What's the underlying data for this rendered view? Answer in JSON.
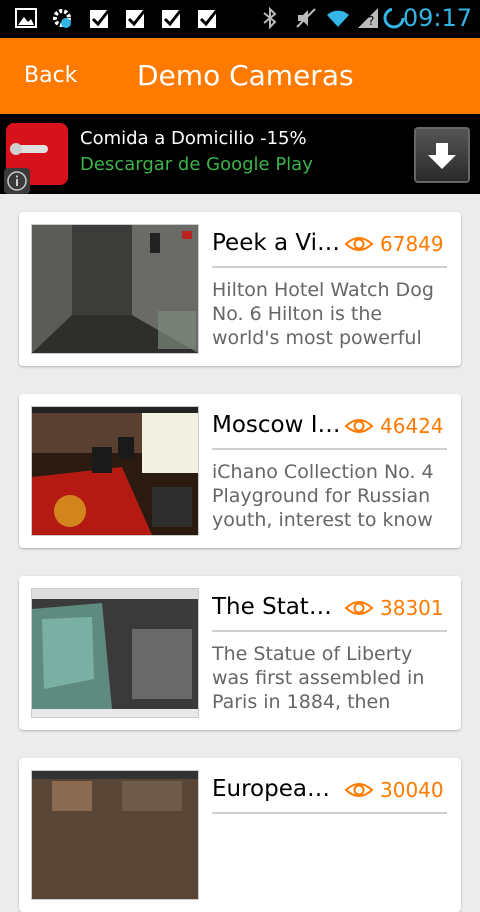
{
  "status_bar": {
    "time": "09:17",
    "icons": [
      "image-icon",
      "settings-sync-icon",
      "checkbox-icon",
      "checkbox-icon",
      "checkbox-icon",
      "checkbox-icon",
      "bluetooth-icon",
      "mute-icon",
      "wifi-icon",
      "signal-icon",
      "sync-icon"
    ]
  },
  "action_bar": {
    "back_label": "Back",
    "title": "Demo Cameras",
    "color": "#ff7a00"
  },
  "ad": {
    "title": "Comida a Domicilio -15%",
    "subtitle": "Descargar de Google Play"
  },
  "cameras": [
    {
      "name": "Peek a Vie…",
      "views": "67849",
      "description": "Hilton Hotel Watch Dog No. 6 Hilton is the world's most powerful"
    },
    {
      "name": "Moscow I…",
      "views": "46424",
      "description": "iChano Collection No. 4 Playground for Russian youth, interest to know"
    },
    {
      "name": "The Statu…",
      "views": "38301",
      "description": "The Statue of Liberty was first assembled in Paris in 1884, then"
    },
    {
      "name": "European…",
      "views": "30040",
      "description": ""
    }
  ]
}
